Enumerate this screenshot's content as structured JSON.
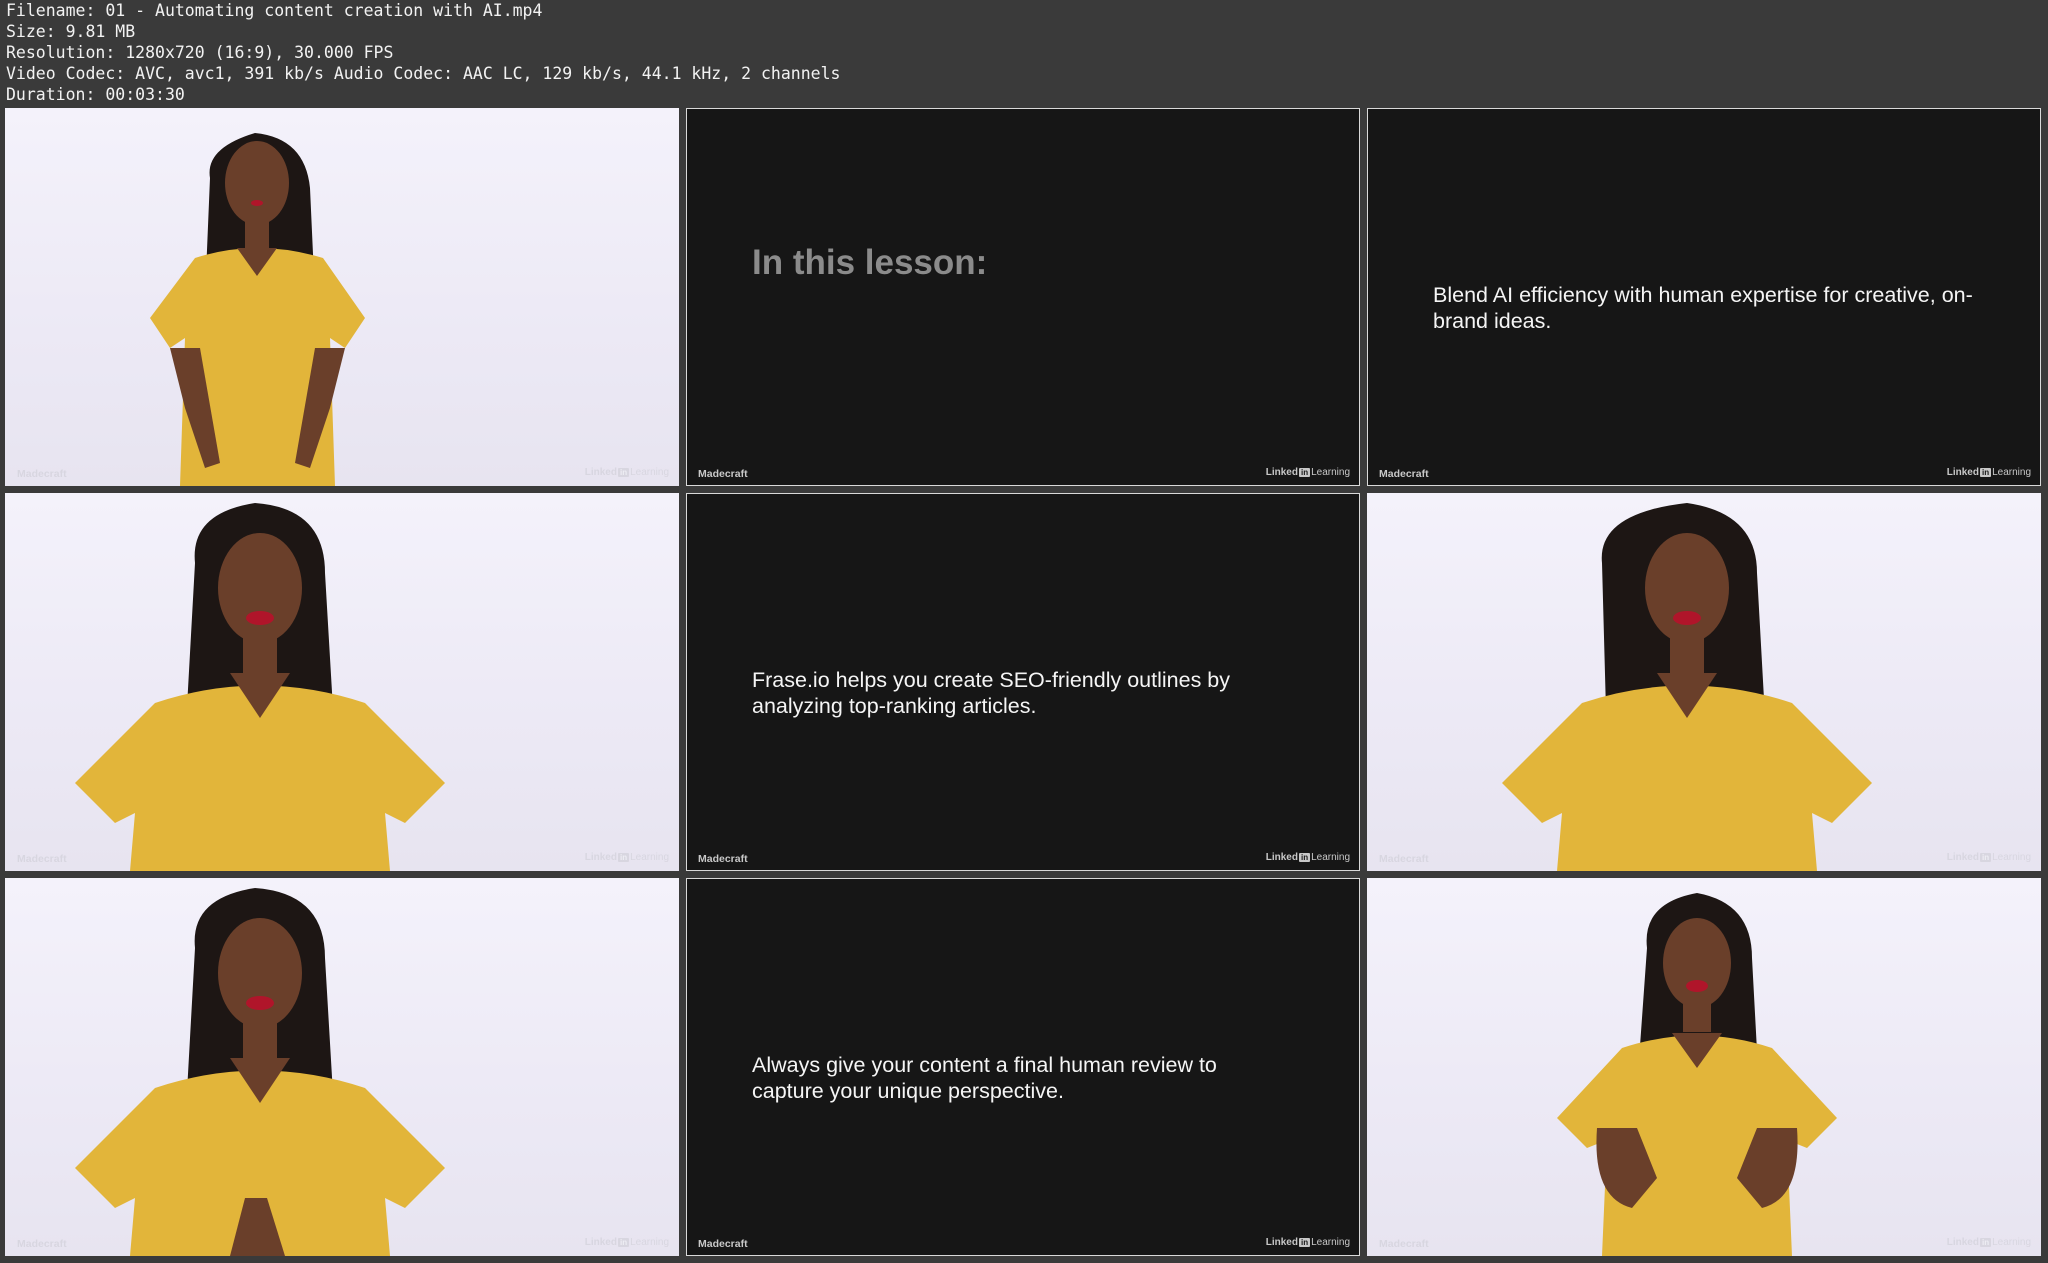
{
  "file_info": {
    "filename": "Filename: 01 - Automating content creation with AI.mp4",
    "size": "Size: 9.81 MB",
    "resolution": "Resolution: 1280x720 (16:9), 30.000 FPS",
    "codec": "Video Codec: AVC, avc1, 391 kb/s Audio Codec: AAC LC, 129 kb/s, 44.1 kHz, 2 channels",
    "duration": "Duration: 00:03:30"
  },
  "brand": {
    "left": "Madecraft",
    "linkedin_prefix": "Linked",
    "linkedin_in": "in",
    "linkedin_suffix": "Learning"
  },
  "slides": {
    "heading": "In this lesson:",
    "blend": "Blend AI efficiency with human expertise for creative, on-brand ideas.",
    "frase": "Frase.io helps you create SEO-friendly outlines by analyzing top-ranking articles.",
    "review": "Always give your content a final human review to capture your unique perspective."
  },
  "colors": {
    "background": "#3a3a3a",
    "slide_bg": "#161616",
    "dress": "#e2b53a",
    "studio_bg": "#f1eff8"
  }
}
